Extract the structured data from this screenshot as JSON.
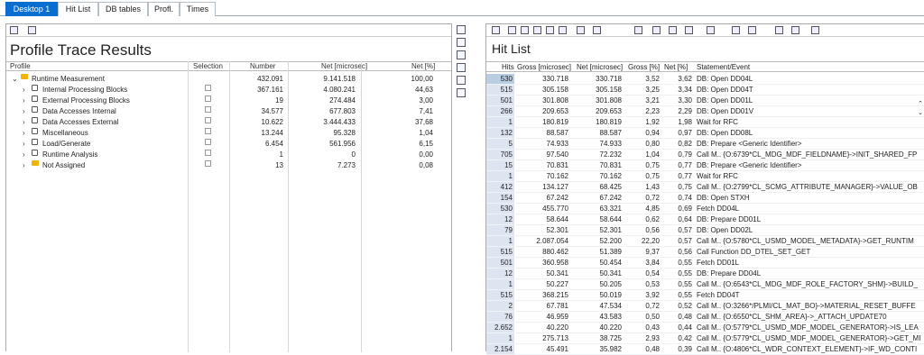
{
  "tabs": [
    "Desktop 1",
    "Hit List",
    "DB tables",
    "Profl.",
    "Times"
  ],
  "left": {
    "title": "Profile Trace Results",
    "columns": [
      "Profile",
      "Selection",
      "Number",
      "Net [microsec]",
      "Net [%]"
    ],
    "rows": [
      {
        "label": "Runtime Measurement",
        "kind": "root",
        "number": "432.091",
        "net": "9.141.518",
        "pct": "100,00",
        "check": false
      },
      {
        "label": "Internal Processing Blocks",
        "kind": "node",
        "number": "367.161",
        "net": "4.080.241",
        "pct": "44,63",
        "check": true
      },
      {
        "label": "External Processing Blocks",
        "kind": "node",
        "number": "19",
        "net": "274.484",
        "pct": "3,00",
        "check": true
      },
      {
        "label": "Data Accesses Internal",
        "kind": "node",
        "number": "34.577",
        "net": "677.803",
        "pct": "7,41",
        "check": true
      },
      {
        "label": "Data Accesses External",
        "kind": "node",
        "number": "10.622",
        "net": "3.444.433",
        "pct": "37,68",
        "check": true
      },
      {
        "label": "Miscellaneous",
        "kind": "node",
        "number": "13.244",
        "net": "95.328",
        "pct": "1,04",
        "check": true
      },
      {
        "label": "Load/Generate",
        "kind": "node",
        "number": "6.454",
        "net": "561.956",
        "pct": "6,15",
        "check": true
      },
      {
        "label": "Runtime Analysis",
        "kind": "node",
        "number": "1",
        "net": "0",
        "pct": "0,00",
        "check": true
      },
      {
        "label": "Not Assigned",
        "kind": "folder",
        "number": "13",
        "net": "7.273",
        "pct": "0,08",
        "check": true
      }
    ]
  },
  "right": {
    "title": "Hit List",
    "columns": [
      "Hits",
      "Gross [microsec]",
      "Net [microsec]",
      "Gross [%]",
      "Net [%]",
      "Statement/Event"
    ],
    "rows": [
      [
        "530",
        "330.718",
        "330.718",
        "3,52",
        "3,62",
        "DB: Open DD04L"
      ],
      [
        "515",
        "305.158",
        "305.158",
        "3,25",
        "3,34",
        "DB: Open DD04T"
      ],
      [
        "501",
        "301.808",
        "301.808",
        "3,21",
        "3,30",
        "DB: Open DD01L"
      ],
      [
        "266",
        "209.653",
        "209.653",
        "2,23",
        "2,29",
        "DB: Open DD01V"
      ],
      [
        "1",
        "180.819",
        "180.819",
        "1,92",
        "1,98",
        "Wait for RFC"
      ],
      [
        "132",
        "88.587",
        "88.587",
        "0,94",
        "0,97",
        "DB: Open DD08L"
      ],
      [
        "5",
        "74.933",
        "74.933",
        "0,80",
        "0,82",
        "DB: Prepare <Generic Identifier>"
      ],
      [
        "705",
        "97.540",
        "72.232",
        "1,04",
        "0,79",
        "Call M.. {O:6739*CL_MDG_MDF_FIELDNAME}->INIT_SHARED_FP"
      ],
      [
        "15",
        "70.831",
        "70.831",
        "0,75",
        "0,77",
        "DB: Prepare <Generic Identifier>"
      ],
      [
        "1",
        "70.162",
        "70.162",
        "0,75",
        "0,77",
        "Wait for RFC"
      ],
      [
        "412",
        "134.127",
        "68.425",
        "1,43",
        "0,75",
        "Call M.. {O:2799*CL_SCMG_ATTRIBUTE_MANAGER}->VALUE_OB"
      ],
      [
        "154",
        "67.242",
        "67.242",
        "0,72",
        "0,74",
        "DB: Open STXH"
      ],
      [
        "530",
        "455.770",
        "63.321",
        "4,85",
        "0,69",
        "Fetch DD04L"
      ],
      [
        "12",
        "58.644",
        "58.644",
        "0,62",
        "0,64",
        "DB: Prepare DD01L"
      ],
      [
        "79",
        "52.301",
        "52.301",
        "0,56",
        "0,57",
        "DB: Open DD02L"
      ],
      [
        "1",
        "2.087.054",
        "52.200",
        "22,20",
        "0,57",
        "Call M.. {O:5780*CL_USMD_MODEL_METADATA}->GET_RUNTIM"
      ],
      [
        "515",
        "880.462",
        "51.389",
        "9,37",
        "0,56",
        "Call Function DD_DTEL_SET_GET"
      ],
      [
        "501",
        "360.958",
        "50.454",
        "3,84",
        "0,55",
        "Fetch DD01L"
      ],
      [
        "12",
        "50.341",
        "50.341",
        "0,54",
        "0,55",
        "DB: Prepare DD04L"
      ],
      [
        "1",
        "50.227",
        "50.205",
        "0,53",
        "0,55",
        "Call M.. {O:6543*CL_MDG_MDF_ROLE_FACTORY_SHM}->BUILD_"
      ],
      [
        "515",
        "368.215",
        "50.019",
        "3,92",
        "0,55",
        "Fetch DD04T"
      ],
      [
        "2",
        "67.781",
        "47.534",
        "0,72",
        "0,52",
        "Call M.. {O:3266*/PLMI/CL_MAT_BO}->MATERIAL_RESET_BUFFE"
      ],
      [
        "76",
        "46.959",
        "43.583",
        "0,50",
        "0,48",
        "Call M.. {O:6550*CL_SHM_AREA}->_ATTACH_UPDATE70"
      ],
      [
        "2.652",
        "40.220",
        "40.220",
        "0,43",
        "0,44",
        "Call M.. {O:5779*CL_USMD_MDF_MODEL_GENERATOR}->IS_LEA"
      ],
      [
        "1",
        "275.713",
        "38.725",
        "2,93",
        "0,42",
        "Call M.. {O:5779*CL_USMD_MDF_MODEL_GENERATOR}->GET_MI"
      ],
      [
        "2.154",
        "45.491",
        "35.982",
        "0,48",
        "0,39",
        "Call M.. {O:4806*CL_WDR_CONTEXT_ELEMENT}->IF_WD_CONTI"
      ]
    ]
  }
}
